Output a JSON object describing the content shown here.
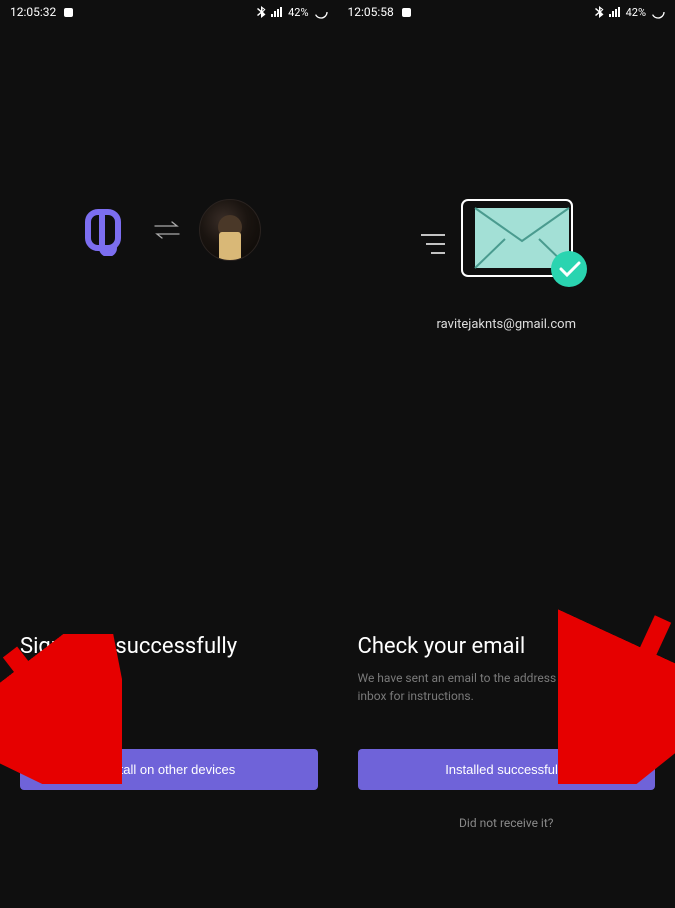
{
  "left": {
    "status": {
      "time": "12:05:32",
      "battery": "42%"
    },
    "title": "Signed in successfully",
    "button": "Install on other devices"
  },
  "right": {
    "status": {
      "time": "12:05:58",
      "battery": "42%"
    },
    "email": "ravitejaknts@gmail.com",
    "title": "Check your email",
    "subtitle": "We have sent an email to the address above, check your inbox for instructions.",
    "button": "Installed successfully",
    "link": "Did not receive it?"
  },
  "colors": {
    "accent": "#6f63d9",
    "logo": "#7c6ef0",
    "check": "#2ad4b0"
  }
}
